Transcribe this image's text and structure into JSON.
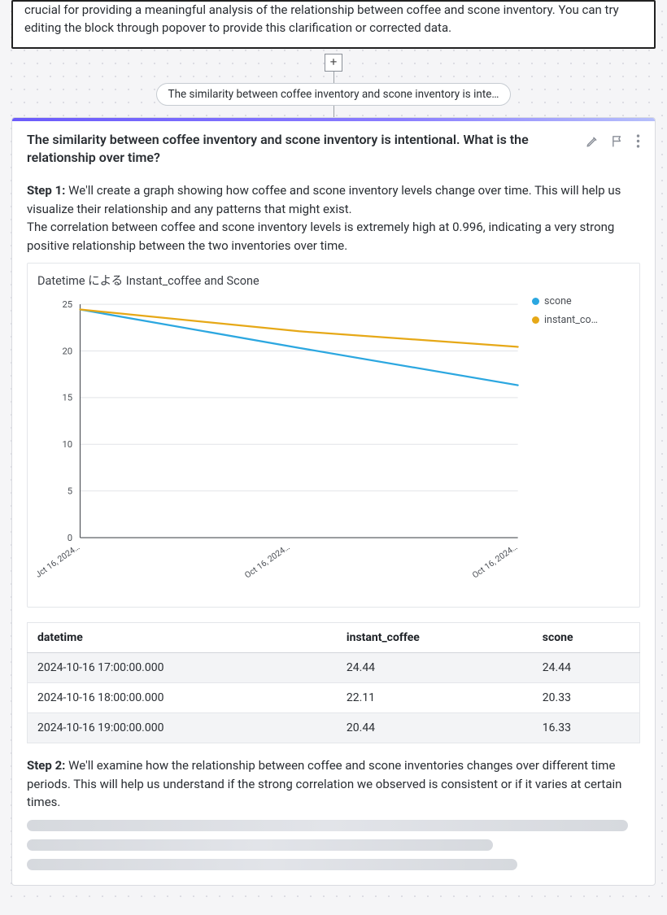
{
  "previous_block": {
    "text": "crucial for providing a meaningful analysis of the relationship between coffee and scone inventory. You can try editing the block through popover to provide this clarification or corrected data."
  },
  "connector_chip": {
    "label": "The similarity between coffee inventory and scone inventory is inte…"
  },
  "card": {
    "title": "The similarity between coffee inventory and scone inventory is intentional. What is the relationship over time?",
    "step1_heading": "Step 1:",
    "step1_body": " We'll create a graph showing how coffee and scone inventory levels change over time. This will help us visualize their relationship and any patterns that might exist.",
    "step1_corr": "The correlation between coffee and scone inventory levels is extremely high at 0.996, indicating a very strong positive relationship between the two inventories over time.",
    "step2_heading": "Step 2:",
    "step2_body": " We'll examine how the relationship between coffee and scone inventories changes over different time periods. This will help us understand if the strong correlation we observed is consistent or if it varies at certain times."
  },
  "chart_data": {
    "type": "line",
    "title": "Datetime による Instant_coffee and Scone",
    "xlabel": "",
    "ylabel": "",
    "ylim": [
      0,
      25
    ],
    "x_ticks": [
      "Jct 16, 2024…",
      "Oct 16, 2024…",
      "Oct 16, 2024…"
    ],
    "y_ticks": [
      0,
      5,
      10,
      15,
      20,
      25
    ],
    "categories": [
      "2024-10-16 17:00:00.000",
      "2024-10-16 18:00:00.000",
      "2024-10-16 19:00:00.000"
    ],
    "series": [
      {
        "name": "scone",
        "color": "#2ca7e0",
        "values": [
          24.44,
          20.33,
          16.33
        ]
      },
      {
        "name": "instant_co…",
        "color": "#e6a817",
        "values": [
          24.44,
          22.11,
          20.44
        ]
      }
    ],
    "legend_position": "right"
  },
  "table": {
    "columns": [
      "datetime",
      "instant_coffee",
      "scone"
    ],
    "rows": [
      [
        "2024-10-16 17:00:00.000",
        "24.44",
        "24.44"
      ],
      [
        "2024-10-16 18:00:00.000",
        "22.11",
        "20.33"
      ],
      [
        "2024-10-16 19:00:00.000",
        "20.44",
        "16.33"
      ]
    ]
  },
  "icons": {
    "plus": "+",
    "edit": "edit-icon",
    "flag": "flag-icon",
    "more": "more-icon"
  }
}
